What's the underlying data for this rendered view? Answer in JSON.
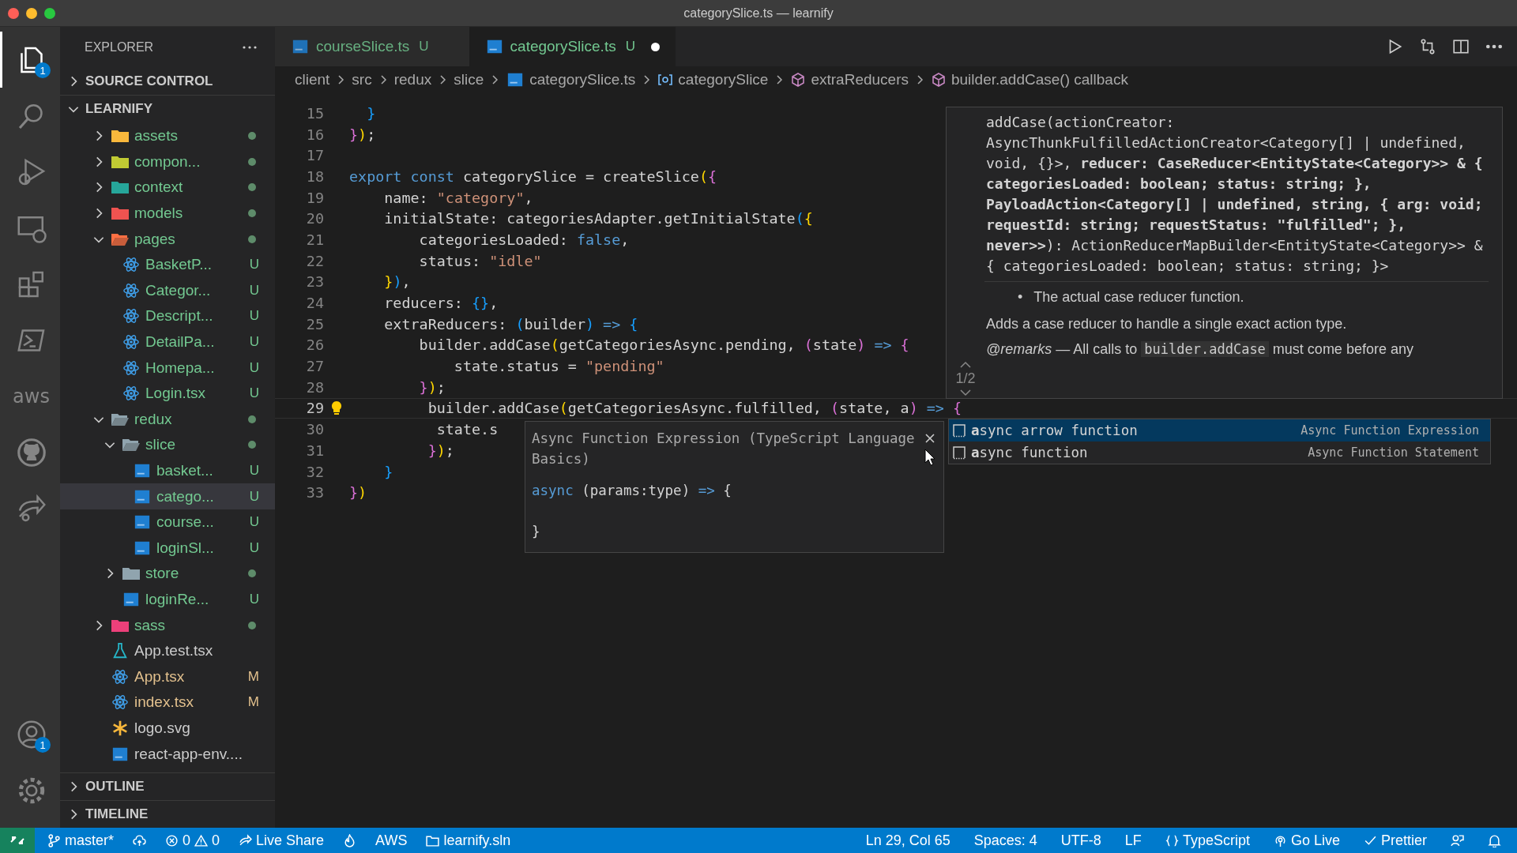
{
  "window": {
    "title": "categorySlice.ts — learnify"
  },
  "activity_bar": {
    "top": [
      {
        "kind": "files",
        "selected": true,
        "badge": "1"
      },
      {
        "kind": "search",
        "selected": false
      },
      {
        "kind": "run",
        "selected": false
      },
      {
        "kind": "remote",
        "selected": false
      },
      {
        "kind": "extensions",
        "selected": false
      },
      {
        "kind": "terminal",
        "selected": false
      },
      {
        "kind": "aws",
        "selected": false,
        "text": "aws"
      },
      {
        "kind": "github",
        "selected": false
      },
      {
        "kind": "liveshare",
        "selected": false
      }
    ],
    "bottom": [
      {
        "kind": "account",
        "badge": "1"
      },
      {
        "kind": "settings"
      }
    ]
  },
  "sidebar": {
    "title": "EXPLORER",
    "sections_top": [
      {
        "label": "SOURCE CONTROL",
        "expanded": false
      }
    ],
    "workspace": {
      "label": "LEARNIFY",
      "expanded": true
    },
    "tree": [
      {
        "label": "assets",
        "kind": "folder",
        "color": "#f9b83c",
        "expanded": false,
        "untracked": true,
        "selected": false
      },
      {
        "label": "compon...",
        "kind": "folder",
        "color": "#c0ca33",
        "expanded": false,
        "untracked": true,
        "selected": false
      },
      {
        "label": "context",
        "kind": "folder",
        "color": "#26a69a",
        "expanded": false,
        "untracked": true,
        "selected": false
      },
      {
        "label": "models",
        "kind": "folder",
        "color": "#ef5350",
        "expanded": false,
        "untracked": true,
        "selected": false
      },
      {
        "label": "pages",
        "kind": "folder",
        "color": "#ff7043",
        "expanded": true,
        "untracked": true,
        "selected": false,
        "children": [
          {
            "label": "BasketP...",
            "kind": "react",
            "untracked": true,
            "badge": "U",
            "selected": false
          },
          {
            "label": "Categor...",
            "kind": "react",
            "untracked": true,
            "badge": "U",
            "selected": false
          },
          {
            "label": "Descript...",
            "kind": "react",
            "untracked": true,
            "badge": "U",
            "selected": false
          },
          {
            "label": "DetailPa...",
            "kind": "react",
            "untracked": true,
            "badge": "U",
            "selected": false
          },
          {
            "label": "Homepa...",
            "kind": "react",
            "untracked": true,
            "badge": "U",
            "selected": false
          },
          {
            "label": "Login.tsx",
            "kind": "react",
            "untracked": true,
            "badge": "U",
            "selected": false
          }
        ]
      },
      {
        "label": "redux",
        "kind": "folder",
        "color": "#90a4ae",
        "expanded": true,
        "untracked": true,
        "selected": false,
        "children": [
          {
            "label": "slice",
            "kind": "folder",
            "color": "#90a4ae",
            "expanded": true,
            "untracked": true,
            "selected": false,
            "children": [
              {
                "label": "basket...",
                "kind": "ts",
                "untracked": true,
                "badge": "U",
                "selected": false
              },
              {
                "label": "catego...",
                "kind": "ts",
                "untracked": true,
                "badge": "U",
                "selected": true
              },
              {
                "label": "course...",
                "kind": "ts",
                "untracked": true,
                "badge": "U",
                "selected": false
              },
              {
                "label": "loginSl...",
                "kind": "ts",
                "untracked": true,
                "badge": "U",
                "selected": false
              }
            ]
          },
          {
            "label": "store",
            "kind": "folder",
            "color": "#90a4ae",
            "expanded": false,
            "untracked": true,
            "selected": false
          },
          {
            "label": "loginRe...",
            "kind": "ts",
            "untracked": true,
            "badge": "U",
            "selected": false
          }
        ]
      },
      {
        "label": "sass",
        "kind": "folder",
        "color": "#ec407a",
        "expanded": false,
        "untracked": true,
        "selected": false
      },
      {
        "label": "App.test.tsx",
        "kind": "test",
        "untracked": false,
        "selected": false
      },
      {
        "label": "App.tsx",
        "kind": "react",
        "untracked": false,
        "modified": true,
        "badge": "M",
        "selected": false
      },
      {
        "label": "index.tsx",
        "kind": "react",
        "untracked": false,
        "modified": true,
        "badge": "M",
        "selected": false
      },
      {
        "label": "logo.svg",
        "kind": "svg",
        "untracked": false,
        "selected": false
      },
      {
        "label": "react-app-env....",
        "kind": "ts",
        "untracked": false,
        "selected": false
      }
    ],
    "sections_bottom": [
      {
        "label": "OUTLINE",
        "expanded": false
      },
      {
        "label": "TIMELINE",
        "expanded": false
      }
    ]
  },
  "tabs": [
    {
      "label": "courseSlice.ts",
      "badge": "U",
      "selected": false,
      "dirty": false
    },
    {
      "label": "categorySlice.ts",
      "badge": "U",
      "selected": true,
      "dirty": true
    }
  ],
  "breadcrumb": [
    {
      "label": "client",
      "kind": "folder"
    },
    {
      "label": "src",
      "kind": "folder"
    },
    {
      "label": "redux",
      "kind": "folder"
    },
    {
      "label": "slice",
      "kind": "folder"
    },
    {
      "label": "categorySlice.ts",
      "kind": "file"
    },
    {
      "label": "categorySlice",
      "kind": "variable"
    },
    {
      "label": "extraReducers",
      "kind": "method"
    },
    {
      "label": "builder.addCase() callback",
      "kind": "method"
    }
  ],
  "code": [
    {
      "number": "15",
      "current": false,
      "tokens": [
        {
          "t": "  }",
          "kind": "b3"
        }
      ]
    },
    {
      "number": "16",
      "current": false,
      "tokens": [
        {
          "t": "}",
          "kind": "b2"
        },
        {
          "t": ")",
          "kind": "b1"
        },
        {
          "t": ";",
          "kind": "p"
        }
      ]
    },
    {
      "number": "17",
      "current": false
    },
    {
      "number": "18",
      "current": false,
      "tokens": [
        {
          "t": "export const",
          "kind": "kw"
        },
        {
          "t": " categorySlice = createSlice",
          "kind": "p"
        },
        {
          "t": "(",
          "kind": "b1"
        },
        {
          "t": "{",
          "kind": "b2"
        }
      ]
    },
    {
      "number": "19",
      "current": false,
      "tokens": [
        {
          "t": "    name: ",
          "kind": "p"
        },
        {
          "t": "\"category\"",
          "kind": "str"
        },
        {
          "t": ",",
          "kind": "p"
        }
      ]
    },
    {
      "number": "20",
      "current": false,
      "tokens": [
        {
          "t": "    initialState: categoriesAdapter.getInitialState",
          "kind": "p"
        },
        {
          "t": "(",
          "kind": "b3"
        },
        {
          "t": "{",
          "kind": "b1"
        }
      ]
    },
    {
      "number": "21",
      "current": false,
      "tokens": [
        {
          "t": "        categoriesLoaded: ",
          "kind": "p"
        },
        {
          "t": "false",
          "kind": "kw"
        },
        {
          "t": ",",
          "kind": "p"
        }
      ]
    },
    {
      "number": "22",
      "current": false,
      "tokens": [
        {
          "t": "        status: ",
          "kind": "p"
        },
        {
          "t": "\"idle\"",
          "kind": "str"
        }
      ]
    },
    {
      "number": "23",
      "current": false,
      "tokens": [
        {
          "t": "    }",
          "kind": "b1"
        },
        {
          "t": ")",
          "kind": "b3"
        },
        {
          "t": ",",
          "kind": "p"
        }
      ]
    },
    {
      "number": "24",
      "current": false,
      "tokens": [
        {
          "t": "    reducers: ",
          "kind": "p"
        },
        {
          "t": "{}",
          "kind": "b3"
        },
        {
          "t": ",",
          "kind": "p"
        }
      ]
    },
    {
      "number": "25",
      "current": false,
      "tokens": [
        {
          "t": "    extraReducers: ",
          "kind": "p"
        },
        {
          "t": "(",
          "kind": "b3"
        },
        {
          "t": "builder",
          "kind": "p"
        },
        {
          "t": ")",
          "kind": "b3"
        },
        {
          "t": " =>",
          "kind": "kw"
        },
        {
          "t": " {",
          "kind": "b3"
        }
      ]
    },
    {
      "number": "26",
      "current": false,
      "tokens": [
        {
          "t": "        builder.addCase",
          "kind": "p"
        },
        {
          "t": "(",
          "kind": "b1"
        },
        {
          "t": "getCategoriesAsync.pending, ",
          "kind": "p"
        },
        {
          "t": "(",
          "kind": "b2"
        },
        {
          "t": "state",
          "kind": "p"
        },
        {
          "t": ")",
          "kind": "b2"
        },
        {
          "t": " =>",
          "kind": "kw"
        },
        {
          "t": " {",
          "kind": "b2"
        }
      ]
    },
    {
      "number": "27",
      "current": false,
      "tokens": [
        {
          "t": "            state.status = ",
          "kind": "p"
        },
        {
          "t": "\"pending\"",
          "kind": "str"
        }
      ]
    },
    {
      "number": "28",
      "current": false,
      "tokens": [
        {
          "t": "        }",
          "kind": "b2"
        },
        {
          "t": ")",
          "kind": "b1"
        },
        {
          "t": ";",
          "kind": "p"
        }
      ]
    },
    {
      "number": "29",
      "current": true,
      "lightbulb": true,
      "tokens": [
        {
          "t": "         builder.addCase",
          "kind": "p"
        },
        {
          "t": "(",
          "kind": "b1"
        },
        {
          "t": "getCategoriesAsync.fulfilled, ",
          "kind": "p"
        },
        {
          "t": "(",
          "kind": "b2"
        },
        {
          "t": "state, a",
          "kind": "p"
        },
        {
          "t": ")",
          "kind": "b2"
        },
        {
          "t": " =>",
          "kind": "kw"
        },
        {
          "t": " {",
          "kind": "b2"
        }
      ]
    },
    {
      "number": "30",
      "current": false,
      "tokens": [
        {
          "t": "          state.s",
          "kind": "p"
        }
      ]
    },
    {
      "number": "31",
      "current": false,
      "tokens": [
        {
          "t": "         }",
          "kind": "b2"
        },
        {
          "t": ")",
          "kind": "b1"
        },
        {
          "t": ";",
          "kind": "p"
        }
      ]
    },
    {
      "number": "32",
      "current": false,
      "tokens": [
        {
          "t": "    }",
          "kind": "b3"
        }
      ]
    },
    {
      "number": "33",
      "current": false,
      "tokens": [
        {
          "t": "}",
          "kind": "b2"
        },
        {
          "t": ")",
          "kind": "b1"
        }
      ]
    }
  ],
  "parameter_hints": {
    "pager": "1/2",
    "signature": "addCase(actionCreator: AsyncThunkFulfilledActionCreator<Category[] | undefined, void, {}>, **reducer: CaseReducer<EntityState<Category>> & { categoriesLoaded: boolean; status: string; }, PayloadAction<Category[] | undefined, string, { arg: void; requestId: string; requestStatus: \"fulfilled\"; }, never>>**): ActionReducerMapBuilder<EntityState<Category>> & { categoriesLoaded: boolean; status: string; }>",
    "param_bullet": "•",
    "param_doc": "The actual case reducer function.",
    "description": "Adds a case reducer to handle a single exact action type.",
    "remarks": {
      "tag": "@remarks",
      "before": "— All calls to",
      "code": "builder.addCase",
      "after": "must come before any"
    }
  },
  "suggestions": [
    {
      "label": "**a**sync arrow function",
      "detail": "Async Function Expression",
      "selected": true
    },
    {
      "label": "**a**sync function",
      "detail": "Async Function Statement",
      "selected": false
    }
  ],
  "suggestion_details": {
    "title": "Async Function Expression (TypeScript Language Basics)",
    "code_tokens": [
      {
        "t": "async",
        "kind": "kw"
      },
      {
        "t": " (params:type) ",
        "kind": "p"
      },
      {
        "t": "=>",
        "kind": "kw"
      },
      {
        "t": " {\n\n}",
        "kind": "p"
      }
    ]
  },
  "status_bar": {
    "left": [
      {
        "kind": "branch",
        "text": "master*"
      },
      {
        "kind": "sync"
      },
      {
        "kind": "problems",
        "errors": "0",
        "warnings": "0"
      },
      {
        "kind": "liveshare",
        "text": "Live Share"
      },
      {
        "kind": "flame"
      },
      {
        "kind": "plain",
        "text": "AWS"
      },
      {
        "kind": "solution",
        "text": "learnify.sln"
      }
    ],
    "right": [
      {
        "kind": "plain",
        "text": "Ln 29, Col 65"
      },
      {
        "kind": "plain",
        "text": "Spaces: 4"
      },
      {
        "kind": "plain",
        "text": "UTF-8"
      },
      {
        "kind": "plain",
        "text": "LF"
      },
      {
        "kind": "language",
        "text": "TypeScript"
      },
      {
        "kind": "golive",
        "text": "Go Live"
      },
      {
        "kind": "check",
        "text": "Prettier"
      },
      {
        "kind": "feedback"
      },
      {
        "kind": "bell"
      }
    ]
  }
}
